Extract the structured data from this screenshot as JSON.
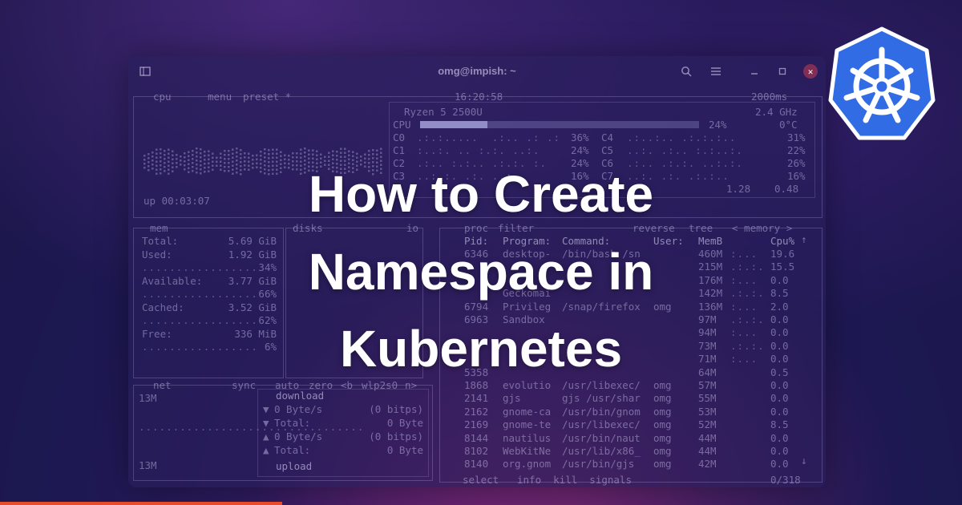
{
  "window": {
    "title": "omg@impish: ~",
    "icons": {
      "new_tab": "new-tab-icon",
      "search": "search-icon",
      "menu": "hamburger-menu-icon",
      "minimize": "minimize-icon",
      "maximize": "maximize-icon",
      "close": "close-icon"
    }
  },
  "cpu_panel": {
    "tabs": [
      "cpu",
      "menu",
      "preset *"
    ],
    "clock": "16:20:58",
    "interval": "2000ms",
    "model": "Ryzen 5 2500U",
    "freq": "2.4 GHz",
    "total_label": "CPU",
    "total_pct": "24%",
    "temp": "0°C",
    "cores_left": [
      {
        "name": "C0",
        "pct": "36%"
      },
      {
        "name": "C1",
        "pct": "24%"
      },
      {
        "name": "C2",
        "pct": "24%"
      },
      {
        "name": "C3",
        "pct": "16%"
      }
    ],
    "cores_right": [
      {
        "name": "C4",
        "pct": "31%"
      },
      {
        "name": "C5",
        "pct": "22%"
      },
      {
        "name": "C6",
        "pct": "26%"
      },
      {
        "name": "C7",
        "pct": "16%"
      }
    ],
    "load_avg": [
      "1.28",
      "0.48"
    ],
    "uptime": "up 00:03:07",
    "total_usage_fraction": 0.24
  },
  "mem_panel": {
    "title": "mem",
    "disks_title": "disks",
    "io": "io",
    "rows": [
      {
        "label": "Total:",
        "value": "5.69 GiB"
      },
      {
        "label": "Used:",
        "value": "1.92 GiB"
      },
      {
        "label": "",
        "value": "34%"
      },
      {
        "label": "Available:",
        "value": "3.77 GiB"
      },
      {
        "label": "",
        "value": "66%"
      },
      {
        "label": "Cached:",
        "value": "3.52 GiB"
      },
      {
        "label": "",
        "value": "62%"
      },
      {
        "label": "Free:",
        "value": "336 MiB"
      },
      {
        "label": "",
        "value": "6%"
      }
    ]
  },
  "net_panel": {
    "title": "net",
    "sync": "sync",
    "auto": "auto",
    "zero": "zero",
    "iface_prev": "<b",
    "iface": "wlp2s0",
    "iface_next": "n>",
    "scale_top": "13M",
    "scale_bottom": "13M",
    "download_label": "download",
    "upload_label": "upload",
    "rows": [
      {
        "arrow": "▼",
        "a": "0 Byte/s",
        "b": "(0 bitps)"
      },
      {
        "arrow": "▼",
        "a": "Total:",
        "b": "0 Byte"
      },
      {
        "arrow": "▲",
        "a": "0 Byte/s",
        "b": "(0 bitps)"
      },
      {
        "arrow": "▲",
        "a": "Total:",
        "b": "0 Byte"
      }
    ]
  },
  "proc_panel": {
    "tabs": [
      "proc",
      "filter",
      "reverse",
      "tree",
      "< memory >"
    ],
    "headers": [
      "Pid:",
      "Program:",
      "Command:",
      "User:",
      "MemB",
      "Cpu%"
    ],
    "rows": [
      {
        "pid": "6346",
        "prog": "desktop-",
        "cmd": "/bin/bash /sn",
        "user": "",
        "mem": "460M",
        "cpu": "19.6"
      },
      {
        "pid": "",
        "prog": "",
        "cmd": "",
        "user": "",
        "mem": "215M",
        "cpu": "15.5"
      },
      {
        "pid": "",
        "prog": "",
        "cmd": "",
        "user": "",
        "mem": "176M",
        "cpu": "0.0"
      },
      {
        "pid": "",
        "prog": "Geckomai",
        "cmd": "",
        "user": "",
        "mem": "142M",
        "cpu": "8.5"
      },
      {
        "pid": "6794",
        "prog": "Privileg",
        "cmd": "/snap/firefox",
        "user": "omg",
        "mem": "136M",
        "cpu": "2.0"
      },
      {
        "pid": "6963",
        "prog": "Sandbox",
        "cmd": "",
        "user": "",
        "mem": "97M",
        "cpu": "0.0"
      },
      {
        "pid": "",
        "prog": "",
        "cmd": "",
        "user": "",
        "mem": "94M",
        "cpu": "0.0"
      },
      {
        "pid": "",
        "prog": "",
        "cmd": "",
        "user": "",
        "mem": "73M",
        "cpu": "0.0"
      },
      {
        "pid": "",
        "prog": "",
        "cmd": "",
        "user": "",
        "mem": "71M",
        "cpu": "0.0"
      },
      {
        "pid": "5358",
        "prog": "",
        "cmd": "",
        "user": "",
        "mem": "64M",
        "cpu": "0.5"
      },
      {
        "pid": "1868",
        "prog": "evolutio",
        "cmd": "/usr/libexec/",
        "user": "omg",
        "mem": "57M",
        "cpu": "0.0"
      },
      {
        "pid": "2141",
        "prog": "gjs",
        "cmd": "gjs /usr/shar",
        "user": "omg",
        "mem": "55M",
        "cpu": "0.0"
      },
      {
        "pid": "2162",
        "prog": "gnome-ca",
        "cmd": "/usr/bin/gnom",
        "user": "omg",
        "mem": "53M",
        "cpu": "0.0"
      },
      {
        "pid": "2169",
        "prog": "gnome-te",
        "cmd": "/usr/libexec/",
        "user": "omg",
        "mem": "52M",
        "cpu": "8.5"
      },
      {
        "pid": "8144",
        "prog": "nautilus",
        "cmd": "/usr/bin/naut",
        "user": "omg",
        "mem": "44M",
        "cpu": "0.0"
      },
      {
        "pid": "8102",
        "prog": "WebKitNe",
        "cmd": "/usr/lib/x86_",
        "user": "omg",
        "mem": "44M",
        "cpu": "0.0"
      },
      {
        "pid": "8140",
        "prog": "org.gnom",
        "cmd": "/usr/bin/gjs",
        "user": "omg",
        "mem": "42M",
        "cpu": "0.0"
      }
    ],
    "footer_left": "select",
    "footer_mid": "info  kill  signals",
    "footer_right": "0/318"
  },
  "headline": {
    "line1": "How to Create",
    "line2": "Namespace in",
    "line3": "Kubernetes"
  },
  "colors": {
    "background": "#1d1852",
    "k8s_blue": "#326ce5",
    "accent_bar": "#e84a2a",
    "headline": "#ffffff"
  }
}
